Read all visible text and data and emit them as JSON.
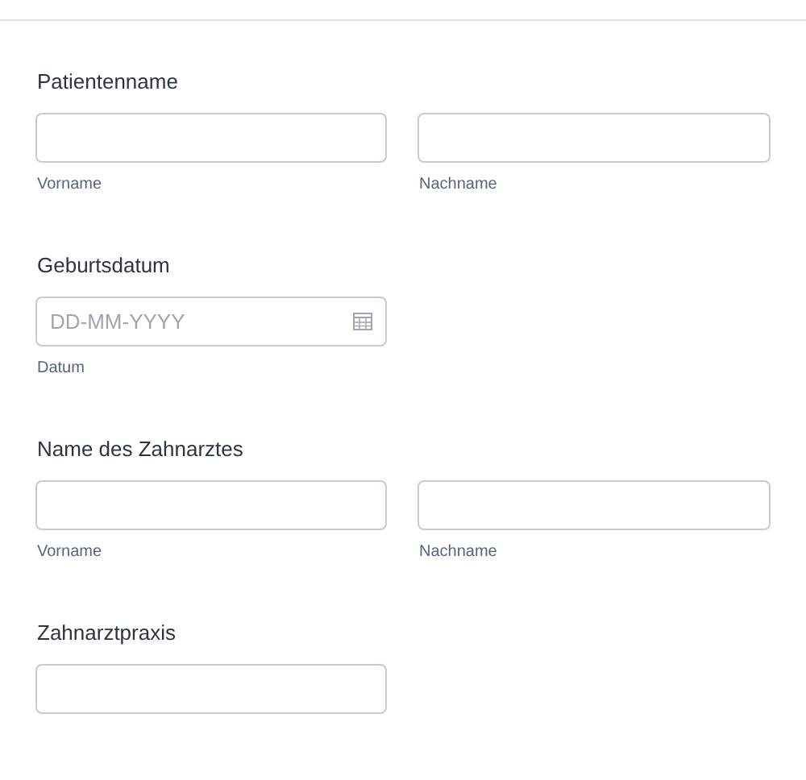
{
  "sections": [
    {
      "label": "Patientenname",
      "fields": [
        {
          "kind": "text",
          "sublabel": "Vorname"
        },
        {
          "kind": "text",
          "sublabel": "Nachname"
        }
      ]
    },
    {
      "label": "Geburtsdatum",
      "fields": [
        {
          "kind": "date",
          "placeholder": "DD-MM-YYYY",
          "sublabel": "Datum"
        }
      ]
    },
    {
      "label": "Name des Zahnarztes",
      "fields": [
        {
          "kind": "text",
          "sublabel": "Vorname"
        },
        {
          "kind": "text",
          "sublabel": "Nachname"
        }
      ]
    },
    {
      "label": "Zahnarztpraxis",
      "fields": [
        {
          "kind": "text"
        }
      ]
    }
  ]
}
